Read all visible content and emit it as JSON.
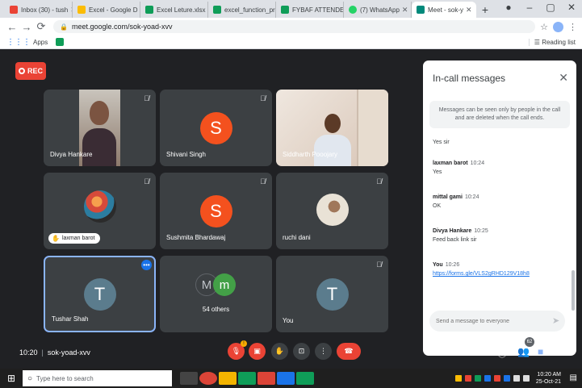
{
  "browser": {
    "tabs": [
      {
        "title": "Inbox (30) - tush",
        "color": "#ea4335"
      },
      {
        "title": "Excel - Google D",
        "color": "#fbbc04"
      },
      {
        "title": "Excel Leture.xlsx",
        "color": "#0f9d58"
      },
      {
        "title": "excel_function_pr",
        "color": "#0f9d58"
      },
      {
        "title": "FYBAF ATTENDE",
        "color": "#0f9d58"
      },
      {
        "title": "(7) WhatsApp",
        "color": "#25d366"
      },
      {
        "title": "Meet - sok-y",
        "color": "#00897b"
      }
    ],
    "new_tab": "+",
    "url": "meet.google.com/sok-yoad-xvv",
    "bookmarks_apps": "Apps",
    "reading_list": "Reading list"
  },
  "meet": {
    "rec_label": "REC",
    "tiles": [
      {
        "name": "Divya Hankare"
      },
      {
        "name": "Shivani Singh",
        "initial": "S"
      },
      {
        "name": "Siddharth Pooojary"
      },
      {
        "name": "laxman barot"
      },
      {
        "name": "Sushmita Bhardawaj",
        "initial": "S"
      },
      {
        "name": "ruchi dani"
      },
      {
        "name": "Tushar Shah",
        "initial": "T"
      },
      {
        "name": "54 others",
        "initial_1": "M",
        "initial_2": "m"
      },
      {
        "name": "You",
        "initial": "T"
      }
    ]
  },
  "chat": {
    "title": "In-call messages",
    "note": "Messages can be seen only by people in the call and are deleted when the call ends.",
    "messages": [
      {
        "sender": "",
        "time": "",
        "text": "Yes sir"
      },
      {
        "sender": "laxman barot",
        "time": "10:24",
        "text": "Yes"
      },
      {
        "sender": "mittal gami",
        "time": "10:24",
        "text": "OK"
      },
      {
        "sender": "Divya Hankare",
        "time": "10:25",
        "text": "Feed back link sir"
      },
      {
        "sender": "You",
        "time": "10:26",
        "text": "https://forms.gle/VLS2gRHD129V18h8"
      }
    ],
    "input_placeholder": "Send a message to everyone"
  },
  "bottom": {
    "time": "10:20",
    "meeting_code": "sok-yoad-xvv",
    "participant_count": "62"
  },
  "taskbar": {
    "search_placeholder": "Type here to search",
    "clock_time": "10:20 AM",
    "clock_date": "25-Oct-21"
  }
}
